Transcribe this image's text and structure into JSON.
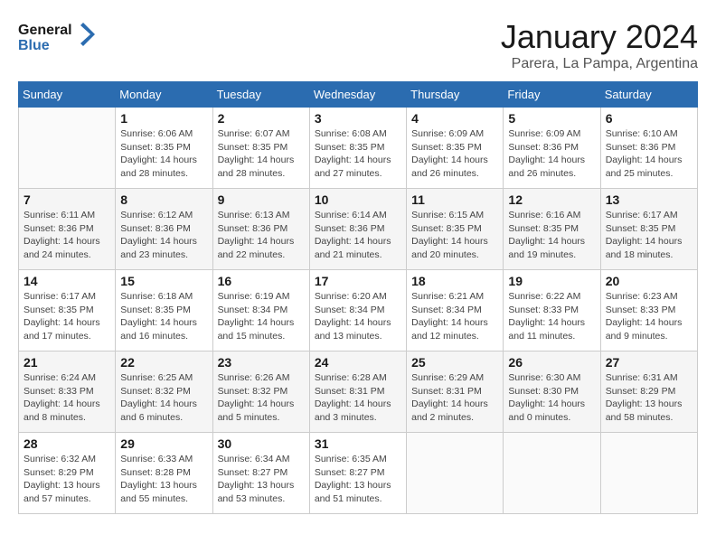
{
  "header": {
    "logo_line1": "General",
    "logo_line2": "Blue",
    "month": "January 2024",
    "location": "Parera, La Pampa, Argentina"
  },
  "weekdays": [
    "Sunday",
    "Monday",
    "Tuesday",
    "Wednesday",
    "Thursday",
    "Friday",
    "Saturday"
  ],
  "weeks": [
    [
      {
        "day": "",
        "sunrise": "",
        "sunset": "",
        "daylight": ""
      },
      {
        "day": "1",
        "sunrise": "Sunrise: 6:06 AM",
        "sunset": "Sunset: 8:35 PM",
        "daylight": "Daylight: 14 hours and 28 minutes."
      },
      {
        "day": "2",
        "sunrise": "Sunrise: 6:07 AM",
        "sunset": "Sunset: 8:35 PM",
        "daylight": "Daylight: 14 hours and 28 minutes."
      },
      {
        "day": "3",
        "sunrise": "Sunrise: 6:08 AM",
        "sunset": "Sunset: 8:35 PM",
        "daylight": "Daylight: 14 hours and 27 minutes."
      },
      {
        "day": "4",
        "sunrise": "Sunrise: 6:09 AM",
        "sunset": "Sunset: 8:35 PM",
        "daylight": "Daylight: 14 hours and 26 minutes."
      },
      {
        "day": "5",
        "sunrise": "Sunrise: 6:09 AM",
        "sunset": "Sunset: 8:36 PM",
        "daylight": "Daylight: 14 hours and 26 minutes."
      },
      {
        "day": "6",
        "sunrise": "Sunrise: 6:10 AM",
        "sunset": "Sunset: 8:36 PM",
        "daylight": "Daylight: 14 hours and 25 minutes."
      }
    ],
    [
      {
        "day": "7",
        "sunrise": "Sunrise: 6:11 AM",
        "sunset": "Sunset: 8:36 PM",
        "daylight": "Daylight: 14 hours and 24 minutes."
      },
      {
        "day": "8",
        "sunrise": "Sunrise: 6:12 AM",
        "sunset": "Sunset: 8:36 PM",
        "daylight": "Daylight: 14 hours and 23 minutes."
      },
      {
        "day": "9",
        "sunrise": "Sunrise: 6:13 AM",
        "sunset": "Sunset: 8:36 PM",
        "daylight": "Daylight: 14 hours and 22 minutes."
      },
      {
        "day": "10",
        "sunrise": "Sunrise: 6:14 AM",
        "sunset": "Sunset: 8:36 PM",
        "daylight": "Daylight: 14 hours and 21 minutes."
      },
      {
        "day": "11",
        "sunrise": "Sunrise: 6:15 AM",
        "sunset": "Sunset: 8:35 PM",
        "daylight": "Daylight: 14 hours and 20 minutes."
      },
      {
        "day": "12",
        "sunrise": "Sunrise: 6:16 AM",
        "sunset": "Sunset: 8:35 PM",
        "daylight": "Daylight: 14 hours and 19 minutes."
      },
      {
        "day": "13",
        "sunrise": "Sunrise: 6:17 AM",
        "sunset": "Sunset: 8:35 PM",
        "daylight": "Daylight: 14 hours and 18 minutes."
      }
    ],
    [
      {
        "day": "14",
        "sunrise": "Sunrise: 6:17 AM",
        "sunset": "Sunset: 8:35 PM",
        "daylight": "Daylight: 14 hours and 17 minutes."
      },
      {
        "day": "15",
        "sunrise": "Sunrise: 6:18 AM",
        "sunset": "Sunset: 8:35 PM",
        "daylight": "Daylight: 14 hours and 16 minutes."
      },
      {
        "day": "16",
        "sunrise": "Sunrise: 6:19 AM",
        "sunset": "Sunset: 8:34 PM",
        "daylight": "Daylight: 14 hours and 15 minutes."
      },
      {
        "day": "17",
        "sunrise": "Sunrise: 6:20 AM",
        "sunset": "Sunset: 8:34 PM",
        "daylight": "Daylight: 14 hours and 13 minutes."
      },
      {
        "day": "18",
        "sunrise": "Sunrise: 6:21 AM",
        "sunset": "Sunset: 8:34 PM",
        "daylight": "Daylight: 14 hours and 12 minutes."
      },
      {
        "day": "19",
        "sunrise": "Sunrise: 6:22 AM",
        "sunset": "Sunset: 8:33 PM",
        "daylight": "Daylight: 14 hours and 11 minutes."
      },
      {
        "day": "20",
        "sunrise": "Sunrise: 6:23 AM",
        "sunset": "Sunset: 8:33 PM",
        "daylight": "Daylight: 14 hours and 9 minutes."
      }
    ],
    [
      {
        "day": "21",
        "sunrise": "Sunrise: 6:24 AM",
        "sunset": "Sunset: 8:33 PM",
        "daylight": "Daylight: 14 hours and 8 minutes."
      },
      {
        "day": "22",
        "sunrise": "Sunrise: 6:25 AM",
        "sunset": "Sunset: 8:32 PM",
        "daylight": "Daylight: 14 hours and 6 minutes."
      },
      {
        "day": "23",
        "sunrise": "Sunrise: 6:26 AM",
        "sunset": "Sunset: 8:32 PM",
        "daylight": "Daylight: 14 hours and 5 minutes."
      },
      {
        "day": "24",
        "sunrise": "Sunrise: 6:28 AM",
        "sunset": "Sunset: 8:31 PM",
        "daylight": "Daylight: 14 hours and 3 minutes."
      },
      {
        "day": "25",
        "sunrise": "Sunrise: 6:29 AM",
        "sunset": "Sunset: 8:31 PM",
        "daylight": "Daylight: 14 hours and 2 minutes."
      },
      {
        "day": "26",
        "sunrise": "Sunrise: 6:30 AM",
        "sunset": "Sunset: 8:30 PM",
        "daylight": "Daylight: 14 hours and 0 minutes."
      },
      {
        "day": "27",
        "sunrise": "Sunrise: 6:31 AM",
        "sunset": "Sunset: 8:29 PM",
        "daylight": "Daylight: 13 hours and 58 minutes."
      }
    ],
    [
      {
        "day": "28",
        "sunrise": "Sunrise: 6:32 AM",
        "sunset": "Sunset: 8:29 PM",
        "daylight": "Daylight: 13 hours and 57 minutes."
      },
      {
        "day": "29",
        "sunrise": "Sunrise: 6:33 AM",
        "sunset": "Sunset: 8:28 PM",
        "daylight": "Daylight: 13 hours and 55 minutes."
      },
      {
        "day": "30",
        "sunrise": "Sunrise: 6:34 AM",
        "sunset": "Sunset: 8:27 PM",
        "daylight": "Daylight: 13 hours and 53 minutes."
      },
      {
        "day": "31",
        "sunrise": "Sunrise: 6:35 AM",
        "sunset": "Sunset: 8:27 PM",
        "daylight": "Daylight: 13 hours and 51 minutes."
      },
      {
        "day": "",
        "sunrise": "",
        "sunset": "",
        "daylight": ""
      },
      {
        "day": "",
        "sunrise": "",
        "sunset": "",
        "daylight": ""
      },
      {
        "day": "",
        "sunrise": "",
        "sunset": "",
        "daylight": ""
      }
    ]
  ],
  "row_classes": [
    "row-light",
    "row-dark",
    "row-light",
    "row-dark",
    "row-light"
  ]
}
